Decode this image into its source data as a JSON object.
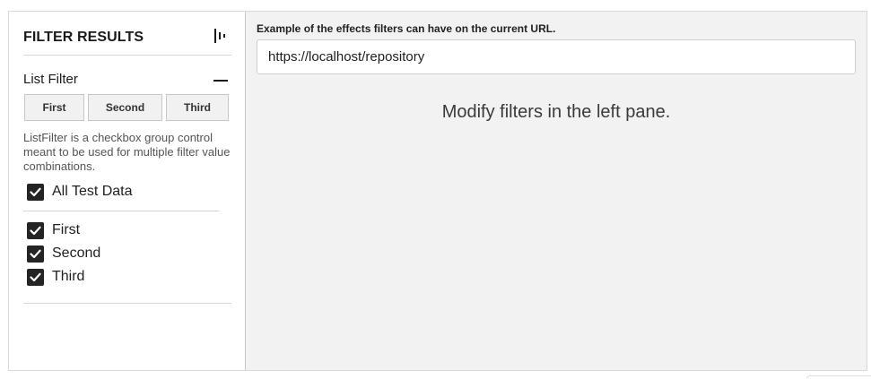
{
  "sidebar": {
    "title": "FILTER RESULTS",
    "collapse_icon": "collapse-pane-icon",
    "list_filter": {
      "title": "List Filter",
      "toggle_icon": "minus-icon",
      "buttons": [
        {
          "label": "First"
        },
        {
          "label": "Second"
        },
        {
          "label": "Third"
        }
      ],
      "description": "ListFilter is a checkbox group control meant to be used for multiple filter value combinations.",
      "all_option": {
        "label": "All Test Data",
        "checked": true
      },
      "options": [
        {
          "label": "First",
          "checked": true
        },
        {
          "label": "Second",
          "checked": true
        },
        {
          "label": "Third",
          "checked": true
        }
      ]
    }
  },
  "main": {
    "url_caption": "Example of the effects filters can have on the current URL.",
    "url_value": "https://localhost/repository",
    "message": "Modify filters in the left pane."
  },
  "colors": {
    "checkbox_fill": "#242424",
    "main_background": "#f2f2f2",
    "button_background": "#f1f1f1"
  }
}
